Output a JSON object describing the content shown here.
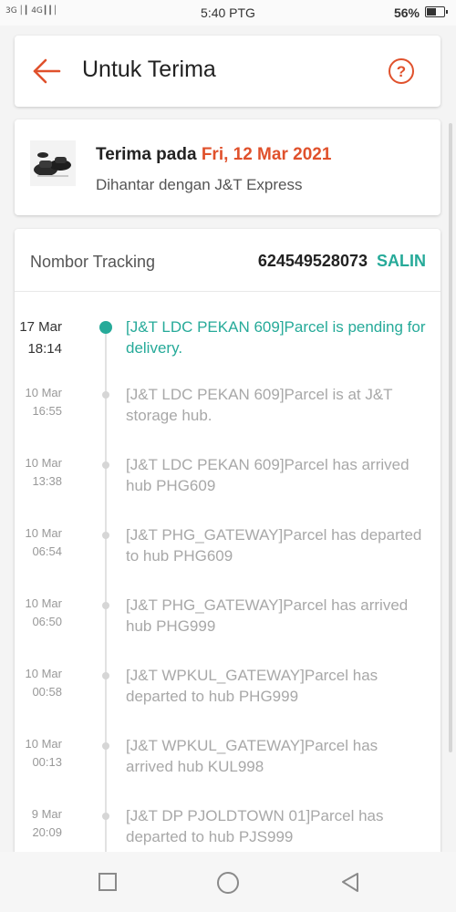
{
  "status_bar": {
    "signal": "3G   ¶ 4G",
    "time": "5:40 PTG",
    "battery_text": "56%",
    "battery_level": 0.56
  },
  "header": {
    "title": "Untuk Terima",
    "back_icon": "arrow-left-icon",
    "help_icon": "question-circle-icon"
  },
  "delivery": {
    "received_prefix": "Terima pada",
    "received_date": "Fri, 12 Mar 2021",
    "carrier": "Dihantar dengan J&T Express"
  },
  "tracking": {
    "label": "Nombor Tracking",
    "number": "624549528073",
    "copy_label": "SALIN",
    "events": [
      {
        "date": "17 Mar",
        "time": "18:14",
        "text": "[J&T LDC PEKAN 609]Parcel is pending for delivery."
      },
      {
        "date": "10 Mar",
        "time": "16:55",
        "text": "[J&T LDC PEKAN 609]Parcel is at J&T storage hub."
      },
      {
        "date": "10 Mar",
        "time": "13:38",
        "text": "[J&T LDC PEKAN 609]Parcel has arrived hub PHG609"
      },
      {
        "date": "10 Mar",
        "time": "06:54",
        "text": "[J&T PHG_GATEWAY]Parcel has departed to hub PHG609"
      },
      {
        "date": "10 Mar",
        "time": "06:50",
        "text": "[J&T PHG_GATEWAY]Parcel has arrived hub PHG999"
      },
      {
        "date": "10 Mar",
        "time": "00:58",
        "text": "[J&T WPKUL_GATEWAY]Parcel has departed to hub PHG999"
      },
      {
        "date": "10 Mar",
        "time": "00:13",
        "text": "[J&T WPKUL_GATEWAY]Parcel has arrived hub KUL998"
      },
      {
        "date": "9 Mar",
        "time": "20:09",
        "text": "[J&T DP PJOLDTOWN 01]Parcel has departed to hub PJS999"
      }
    ]
  },
  "colors": {
    "accent": "#e0512c",
    "teal": "#26aa99"
  }
}
